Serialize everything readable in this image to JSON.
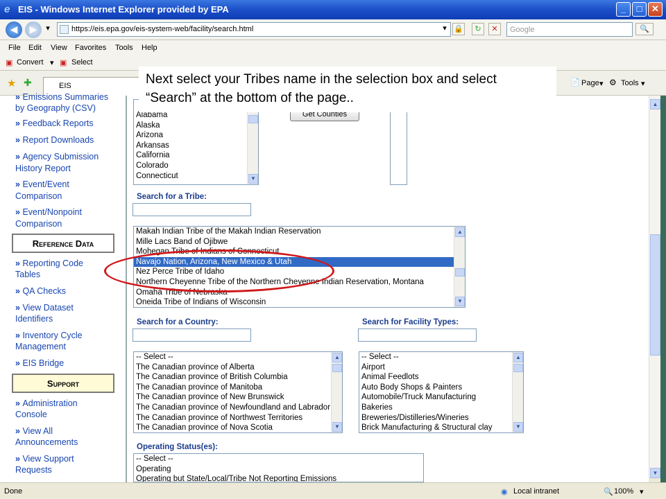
{
  "window": {
    "title": "EIS - Windows Internet Explorer provided by EPA"
  },
  "address": {
    "url": "https://eis.epa.gov/eis-system-web/facility/search.html",
    "search_placeholder": "Google"
  },
  "menu": [
    "File",
    "Edit",
    "View",
    "Favorites",
    "Tools",
    "Help"
  ],
  "commands": {
    "convert": "Convert",
    "select": "Select",
    "page": "Page",
    "tools": "Tools"
  },
  "tab": {
    "label": "EIS"
  },
  "callout": {
    "text": "Next select your Tribes name in the selection box and select “Search” at the bottom of the page.."
  },
  "leftnav": {
    "top_partial": "Emissions Summaries",
    "geo_cont": "by Geography (CSV)",
    "feedback": "Feedback Reports",
    "report_downloads": "Report Downloads",
    "agency_1": "Agency Submission",
    "agency_2": "History Report",
    "event_event_1": "Event/Event",
    "event_event_2": "Comparison",
    "event_nonpoint_1": "Event/Nonpoint",
    "event_nonpoint_2": "Comparison",
    "reference_head": "Reference Data",
    "reporting_1": "Reporting Code",
    "reporting_2": "Tables",
    "qa": "QA Checks",
    "dataset_1": "View Dataset",
    "dataset_2": "Identifiers",
    "inventory_1": "Inventory Cycle",
    "inventory_2": "Management",
    "bridge": "EIS Bridge",
    "support_head": "Support",
    "admin_1": "Administration",
    "admin_2": "Console",
    "viewall_1": "View All",
    "viewall_2": "Announcements",
    "viewsupport_1": "View Support",
    "viewsupport_2": "Requests"
  },
  "states": [
    "Alabama",
    "Alaska",
    "Arizona",
    "Arkansas",
    "California",
    "Colorado",
    "Connecticut"
  ],
  "get_counties": "Get Counties",
  "tribe_label": "Search for a Tribe:",
  "tribes": [
    "Makah Indian Tribe of the Makah Indian Reservation",
    "Mille Lacs Band of Ojibwe",
    "Mohegan Tribe of Indians of Connecticut",
    "Navajo Nation, Arizona, New Mexico & Utah",
    "Nez Perce Tribe of Idaho",
    "Northern Cheyenne Tribe of the Northern Cheyenne Indian Reservation, Montana",
    "Omaha Tribe of Nebraska",
    "Oneida Tribe of Indians of Wisconsin"
  ],
  "tribe_selected_index": 3,
  "country_label": "Search for a Country:",
  "countries": [
    "-- Select --",
    "The Canadian province of Alberta",
    "The Canadian province of British Columbia",
    "The Canadian province of Manitoba",
    "The Canadian province of New Brunswick",
    "The Canadian province of Newfoundland and Labrador",
    "The Canadian province of Northwest Territories",
    "The Canadian province of Nova Scotia"
  ],
  "facility_label": "Search for Facility Types:",
  "facility_types": [
    "-- Select --",
    "Airport",
    "Animal Feedlots",
    "Auto Body Shops & Painters",
    "Automobile/Truck Manufacturing",
    "Bakeries",
    "Breweries/Distilleries/Wineries",
    "Brick Manufacturing & Structural clay"
  ],
  "status_label": "Operating Status(es):",
  "statuses": [
    "-- Select --",
    "Operating",
    "Operating but State/Local/Tribe Not Reporting Emissions"
  ],
  "statusbar": {
    "left": "Done",
    "zone": "Local intranet",
    "zoom": "100%"
  }
}
